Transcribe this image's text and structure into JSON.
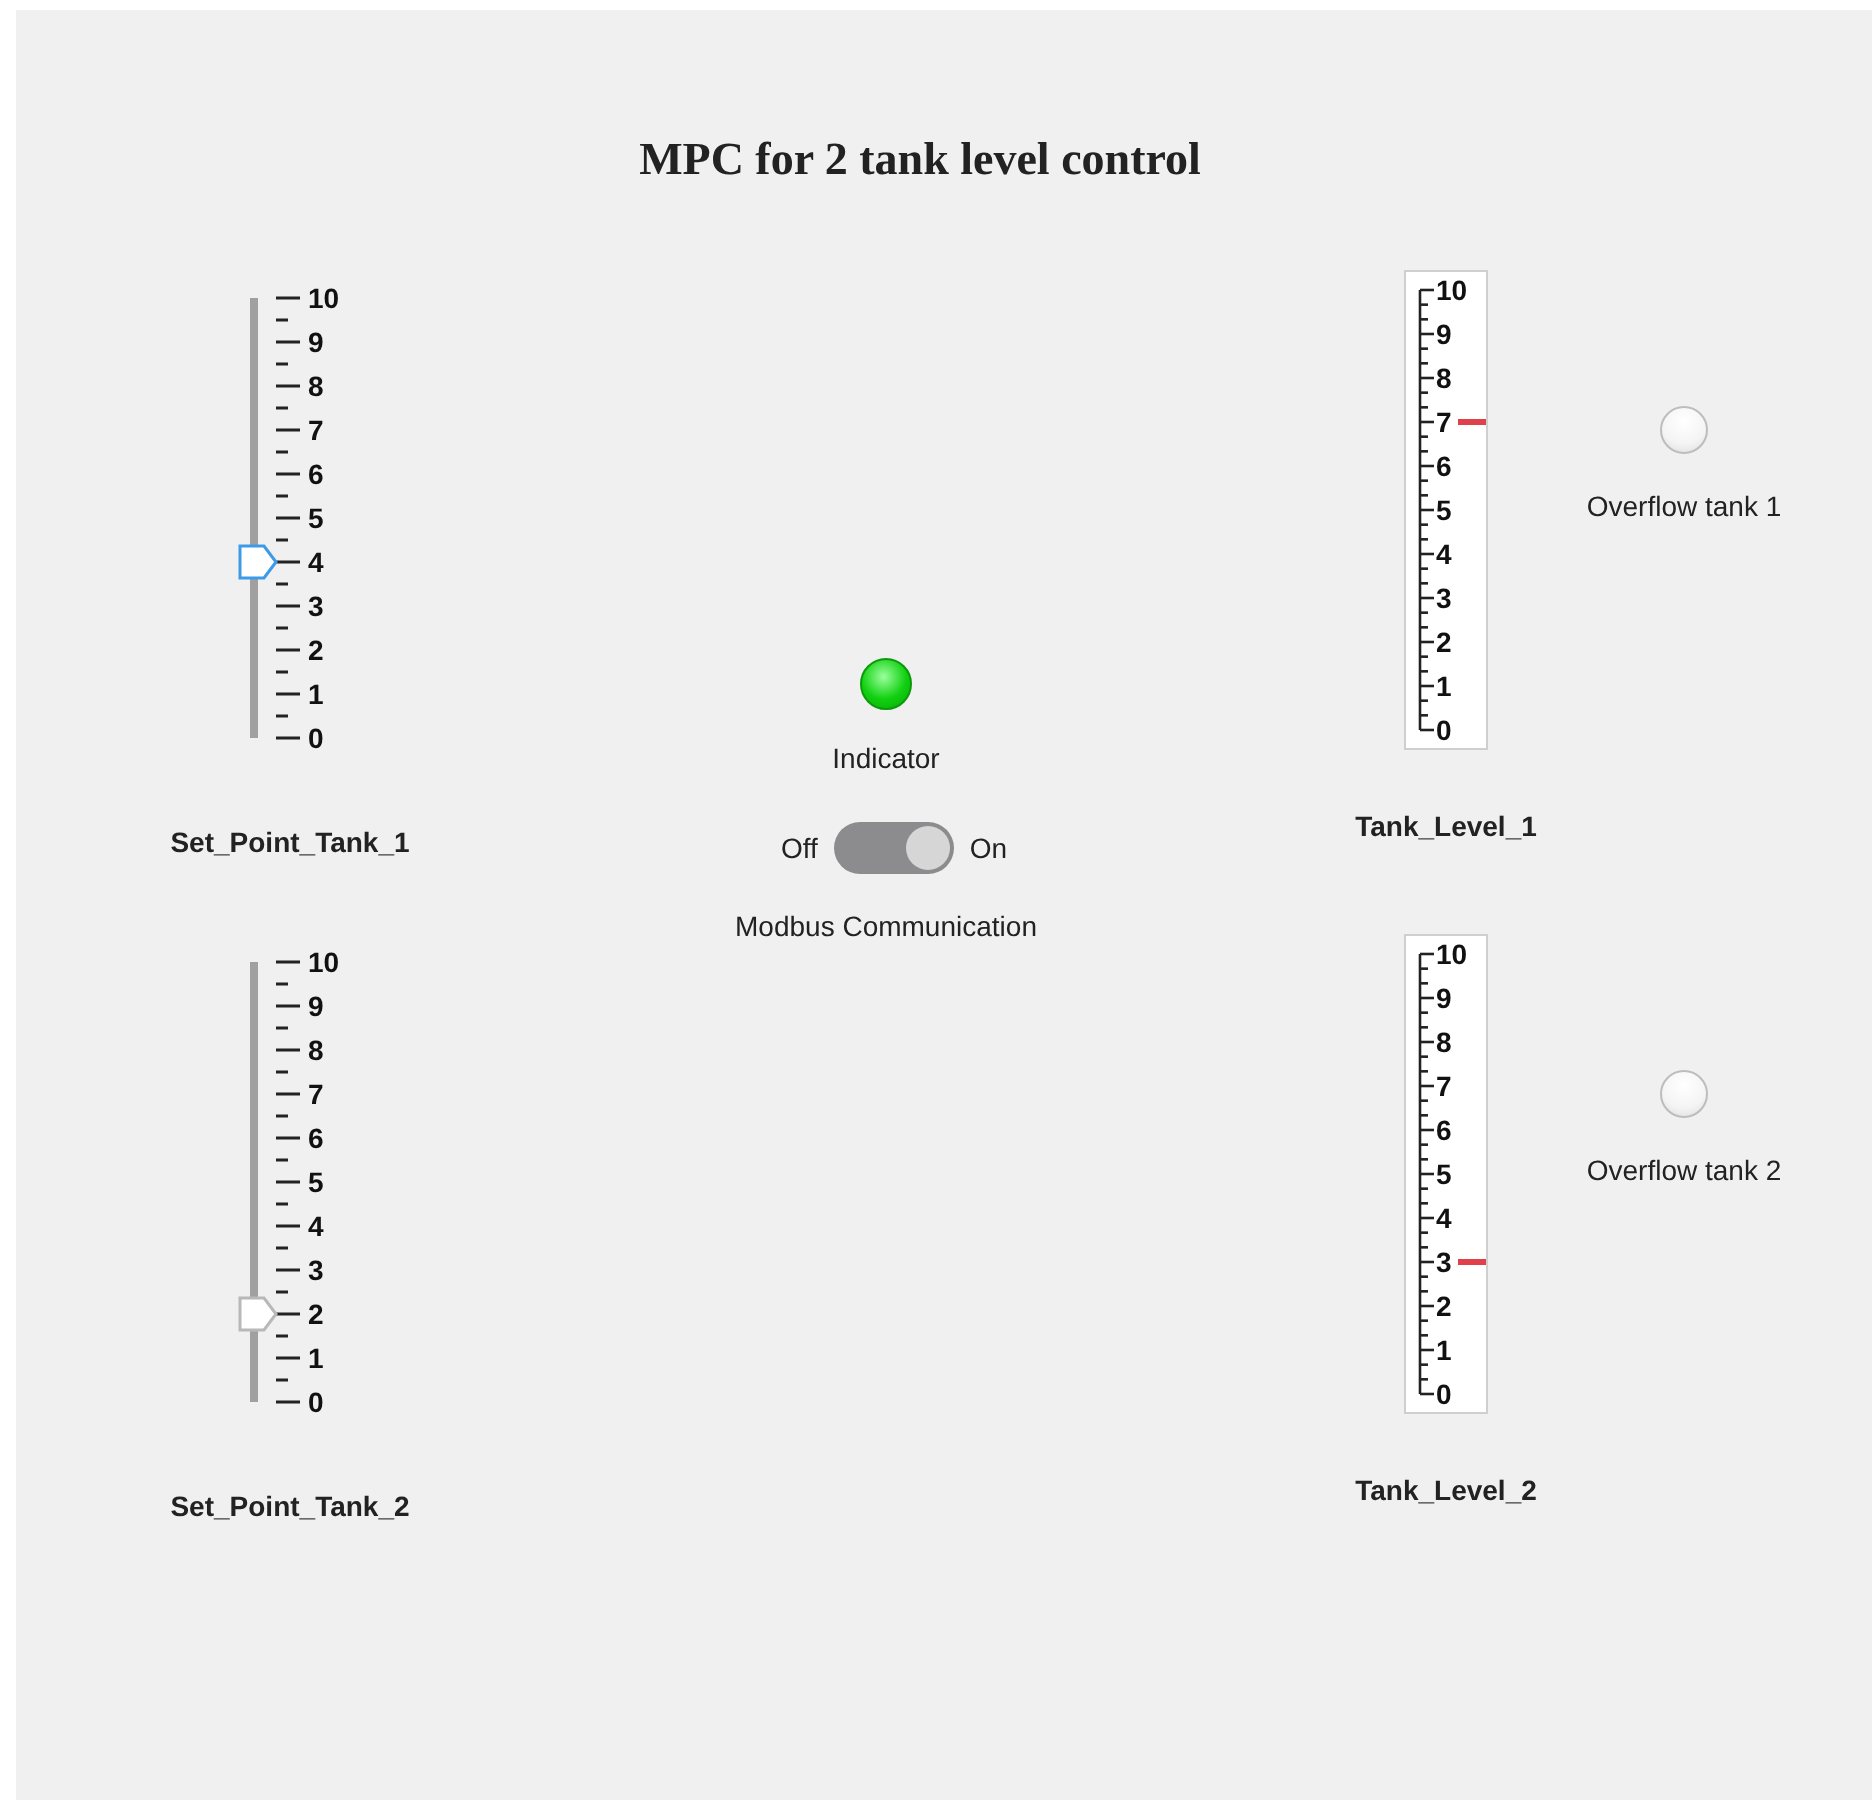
{
  "title": "MPC for 2 tank level control",
  "setpoints": [
    {
      "label": "Set_Point_Tank_1",
      "ticks": [
        "10",
        "9",
        "8",
        "7",
        "6",
        "5",
        "4",
        "3",
        "2",
        "1",
        "0"
      ],
      "level": 0.4,
      "focused": true
    },
    {
      "label": "Set_Point_Tank_2",
      "ticks": [
        "10",
        "9",
        "8",
        "7",
        "6",
        "5",
        "4",
        "3",
        "2",
        "1",
        "0"
      ],
      "level": 0.2,
      "focused": false
    }
  ],
  "indicator": {
    "label": "Indicator",
    "on": true
  },
  "switch": {
    "off_label": "Off",
    "on_label": "On",
    "on": true,
    "label": "Modbus Communication"
  },
  "tanks": [
    {
      "label": "Tank_Level_1",
      "ticks": [
        "10",
        "9",
        "8",
        "7",
        "6",
        "5",
        "4",
        "3",
        "2",
        "1",
        "0"
      ],
      "level": 0.7,
      "overflow": {
        "label": "Overflow tank 1",
        "on": false
      }
    },
    {
      "label": "Tank_Level_2",
      "ticks": [
        "10",
        "9",
        "8",
        "7",
        "6",
        "5",
        "4",
        "3",
        "2",
        "1",
        "0"
      ],
      "level": 0.3,
      "overflow": {
        "label": "Overflow tank 2",
        "on": false
      }
    }
  ]
}
